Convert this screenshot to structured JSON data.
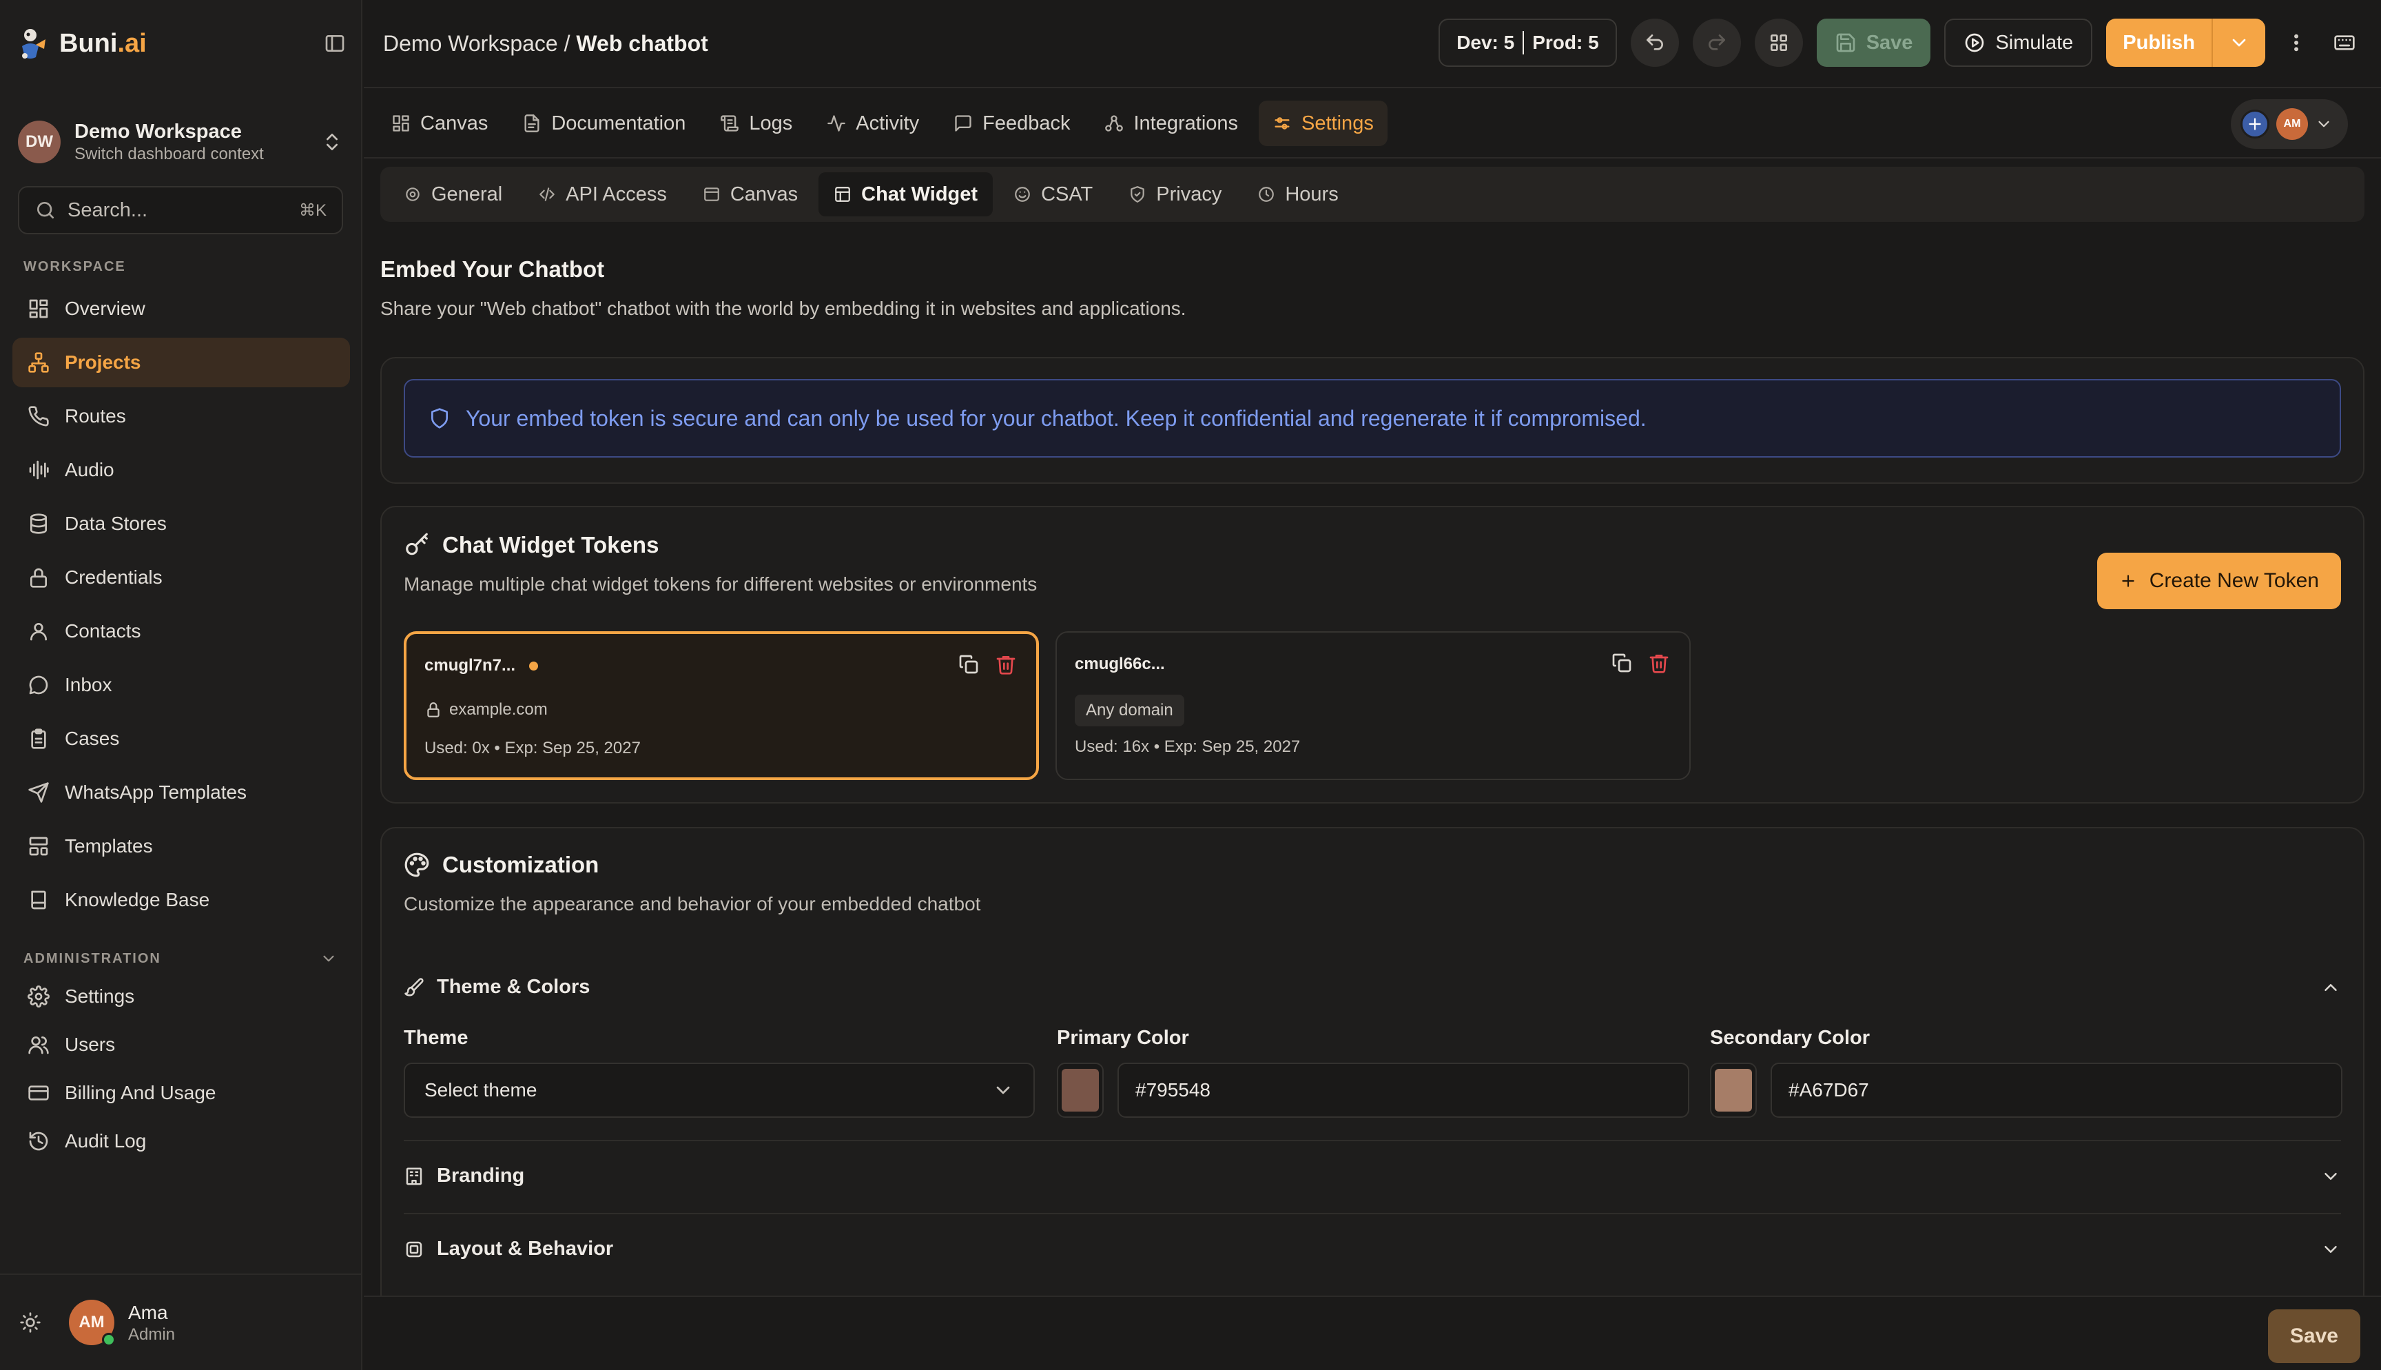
{
  "app": {
    "logo_text": "Buni",
    "logo_suffix": ".ai"
  },
  "workspace": {
    "initials": "DW",
    "name": "Demo Workspace",
    "subtitle": "Switch dashboard context"
  },
  "search": {
    "placeholder": "Search...",
    "shortcut": "⌘K"
  },
  "sidebar": {
    "section_workspace": "WORKSPACE",
    "items": [
      {
        "label": "Overview",
        "icon": "grid-icon"
      },
      {
        "label": "Projects",
        "icon": "projects-icon",
        "active": true
      },
      {
        "label": "Routes",
        "icon": "phone-icon"
      },
      {
        "label": "Audio",
        "icon": "audio-wave-icon"
      },
      {
        "label": "Data Stores",
        "icon": "database-icon"
      },
      {
        "label": "Credentials",
        "icon": "lock-icon"
      },
      {
        "label": "Contacts",
        "icon": "user-icon"
      },
      {
        "label": "Inbox",
        "icon": "message-circle-icon"
      },
      {
        "label": "Cases",
        "icon": "clipboard-icon"
      },
      {
        "label": "WhatsApp Templates",
        "icon": "send-icon"
      },
      {
        "label": "Templates",
        "icon": "layout-icon"
      },
      {
        "label": "Knowledge Base",
        "icon": "book-icon"
      }
    ],
    "section_admin": "ADMINISTRATION",
    "admin_items": [
      {
        "label": "Settings",
        "icon": "gear-icon"
      },
      {
        "label": "Users",
        "icon": "users-icon"
      },
      {
        "label": "Billing And Usage",
        "icon": "credit-card-icon"
      },
      {
        "label": "Audit Log",
        "icon": "history-icon"
      }
    ]
  },
  "user": {
    "initials": "AM",
    "name": "Ama",
    "role": "Admin",
    "status_color": "#3fbf5c"
  },
  "header": {
    "breadcrumb_workspace": "Demo Workspace",
    "breadcrumb_sep": " / ",
    "breadcrumb_project": "Web chatbot",
    "env_dev": "Dev: 5",
    "env_prod": "Prod: 5",
    "save_label": "Save",
    "simulate_label": "Simulate",
    "publish_label": "Publish"
  },
  "main_tabs": [
    {
      "label": "Canvas",
      "icon": "grid-icon"
    },
    {
      "label": "Documentation",
      "icon": "file-icon"
    },
    {
      "label": "Logs",
      "icon": "scroll-icon"
    },
    {
      "label": "Activity",
      "icon": "activity-icon"
    },
    {
      "label": "Feedback",
      "icon": "message-square-icon"
    },
    {
      "label": "Integrations",
      "icon": "integrations-icon"
    },
    {
      "label": "Settings",
      "icon": "sliders-icon",
      "active": true
    }
  ],
  "collaborators": {
    "initials": "AM"
  },
  "sub_tabs": [
    {
      "label": "General",
      "icon": "gear-icon"
    },
    {
      "label": "API Access",
      "icon": "code-icon"
    },
    {
      "label": "Canvas",
      "icon": "panel-icon"
    },
    {
      "label": "Chat Widget",
      "icon": "widget-icon",
      "active": true
    },
    {
      "label": "CSAT",
      "icon": "smile-icon"
    },
    {
      "label": "Privacy",
      "icon": "shield-check-icon"
    },
    {
      "label": "Hours",
      "icon": "clock-icon"
    }
  ],
  "embed": {
    "title": "Embed Your Chatbot",
    "description": "Share your \"Web chatbot\" chatbot with the world by embedding it in websites and applications.",
    "notice": "Your embed token is secure and can only be used for your chatbot. Keep it confidential and regenerate it if compromised."
  },
  "tokens_section": {
    "title": "Chat Widget Tokens",
    "subtitle": "Manage multiple chat widget tokens for different websites or environments",
    "create_label": "Create New Token",
    "tokens": [
      {
        "id": "cmugl7n7...",
        "domain": "example.com",
        "usage": "Used: 0x • Exp: Sep 25, 2027",
        "selected": true
      },
      {
        "id": "cmugl66c...",
        "domain": "Any domain",
        "usage": "Used: 16x • Exp: Sep 25, 2027",
        "selected": false
      }
    ]
  },
  "customization": {
    "title": "Customization",
    "subtitle": "Customize the appearance and behavior of your embedded chatbot",
    "theme_section": "Theme & Colors",
    "theme_label": "Theme",
    "theme_value": "Select theme",
    "primary_label": "Primary Color",
    "primary_value": "#795548",
    "secondary_label": "Secondary Color",
    "secondary_value": "#A67D67",
    "branding_label": "Branding",
    "layout_label": "Layout & Behavior"
  },
  "footer": {
    "save_label": "Save"
  },
  "colors": {
    "accent": "#f5a545",
    "primary_swatch": "#795548",
    "secondary_swatch": "#A67D67",
    "danger": "#e5484d",
    "info": "#7e9cf0"
  }
}
